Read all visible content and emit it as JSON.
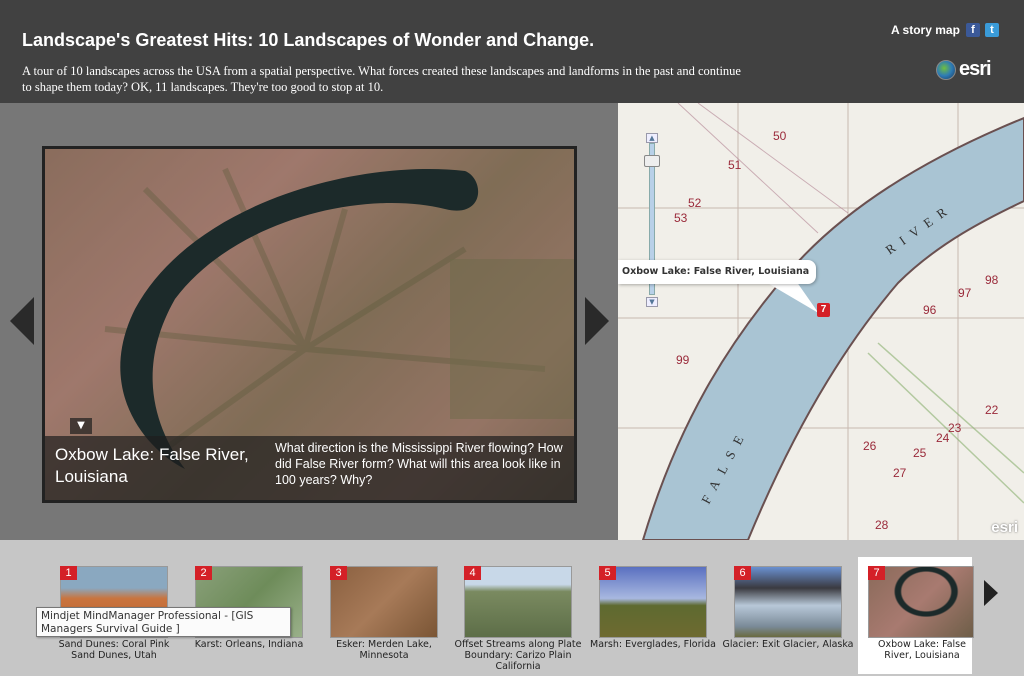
{
  "header": {
    "title": "Landscape's Greatest Hits: 10 Landscapes of Wonder and Change.",
    "subtitle": "A tour of 10 landscapes across the USA from a spatial perspective. What forces created these landscapes and landforms in the past and continue to shape them today? OK, 11 landscapes. They're too good to stop at 10.",
    "story_map_label": "A story map",
    "facebook_icon": "f",
    "twitter_icon": "t",
    "logo_text": "esri"
  },
  "slide": {
    "title": "Oxbow Lake: False River, Louisiana",
    "text": "What direction is the Mississippi River flowing? How did False River form? What will this area look like in 100 years? Why?",
    "toggle_icon": "▼"
  },
  "map": {
    "popup": "Oxbow Lake: False River, Louisiana",
    "marker": "7",
    "labels": [
      "50",
      "51",
      "52",
      "53",
      "96",
      "97",
      "98",
      "99",
      "22",
      "23",
      "24",
      "25",
      "26",
      "27",
      "28"
    ],
    "river_labels": [
      "RIVER",
      "FALSE"
    ],
    "logo": "esri",
    "colors": {
      "water": "#a9c4d3",
      "land": "#f1efe9",
      "contour": "#a08070"
    }
  },
  "thumbnails": [
    {
      "num": "1",
      "caption": "Sand Dunes: Coral Pink Sand Dunes, Utah"
    },
    {
      "num": "2",
      "caption": "Karst: Orleans, Indiana"
    },
    {
      "num": "3",
      "caption": "Esker: Merden Lake, Minnesota"
    },
    {
      "num": "4",
      "caption": "Offset Streams along Plate Boundary: Carizo Plain California"
    },
    {
      "num": "5",
      "caption": "Marsh: Everglades, Florida"
    },
    {
      "num": "6",
      "caption": "Glacier: Exit Glacier, Alaska"
    },
    {
      "num": "7",
      "caption": "Oxbow Lake: False River, Louisiana",
      "selected": true
    }
  ],
  "tooltip": "Mindjet MindManager Professional - [GIS Managers Survival Guide ]",
  "colors": {
    "accent": "#d42027",
    "header": "#414141"
  }
}
